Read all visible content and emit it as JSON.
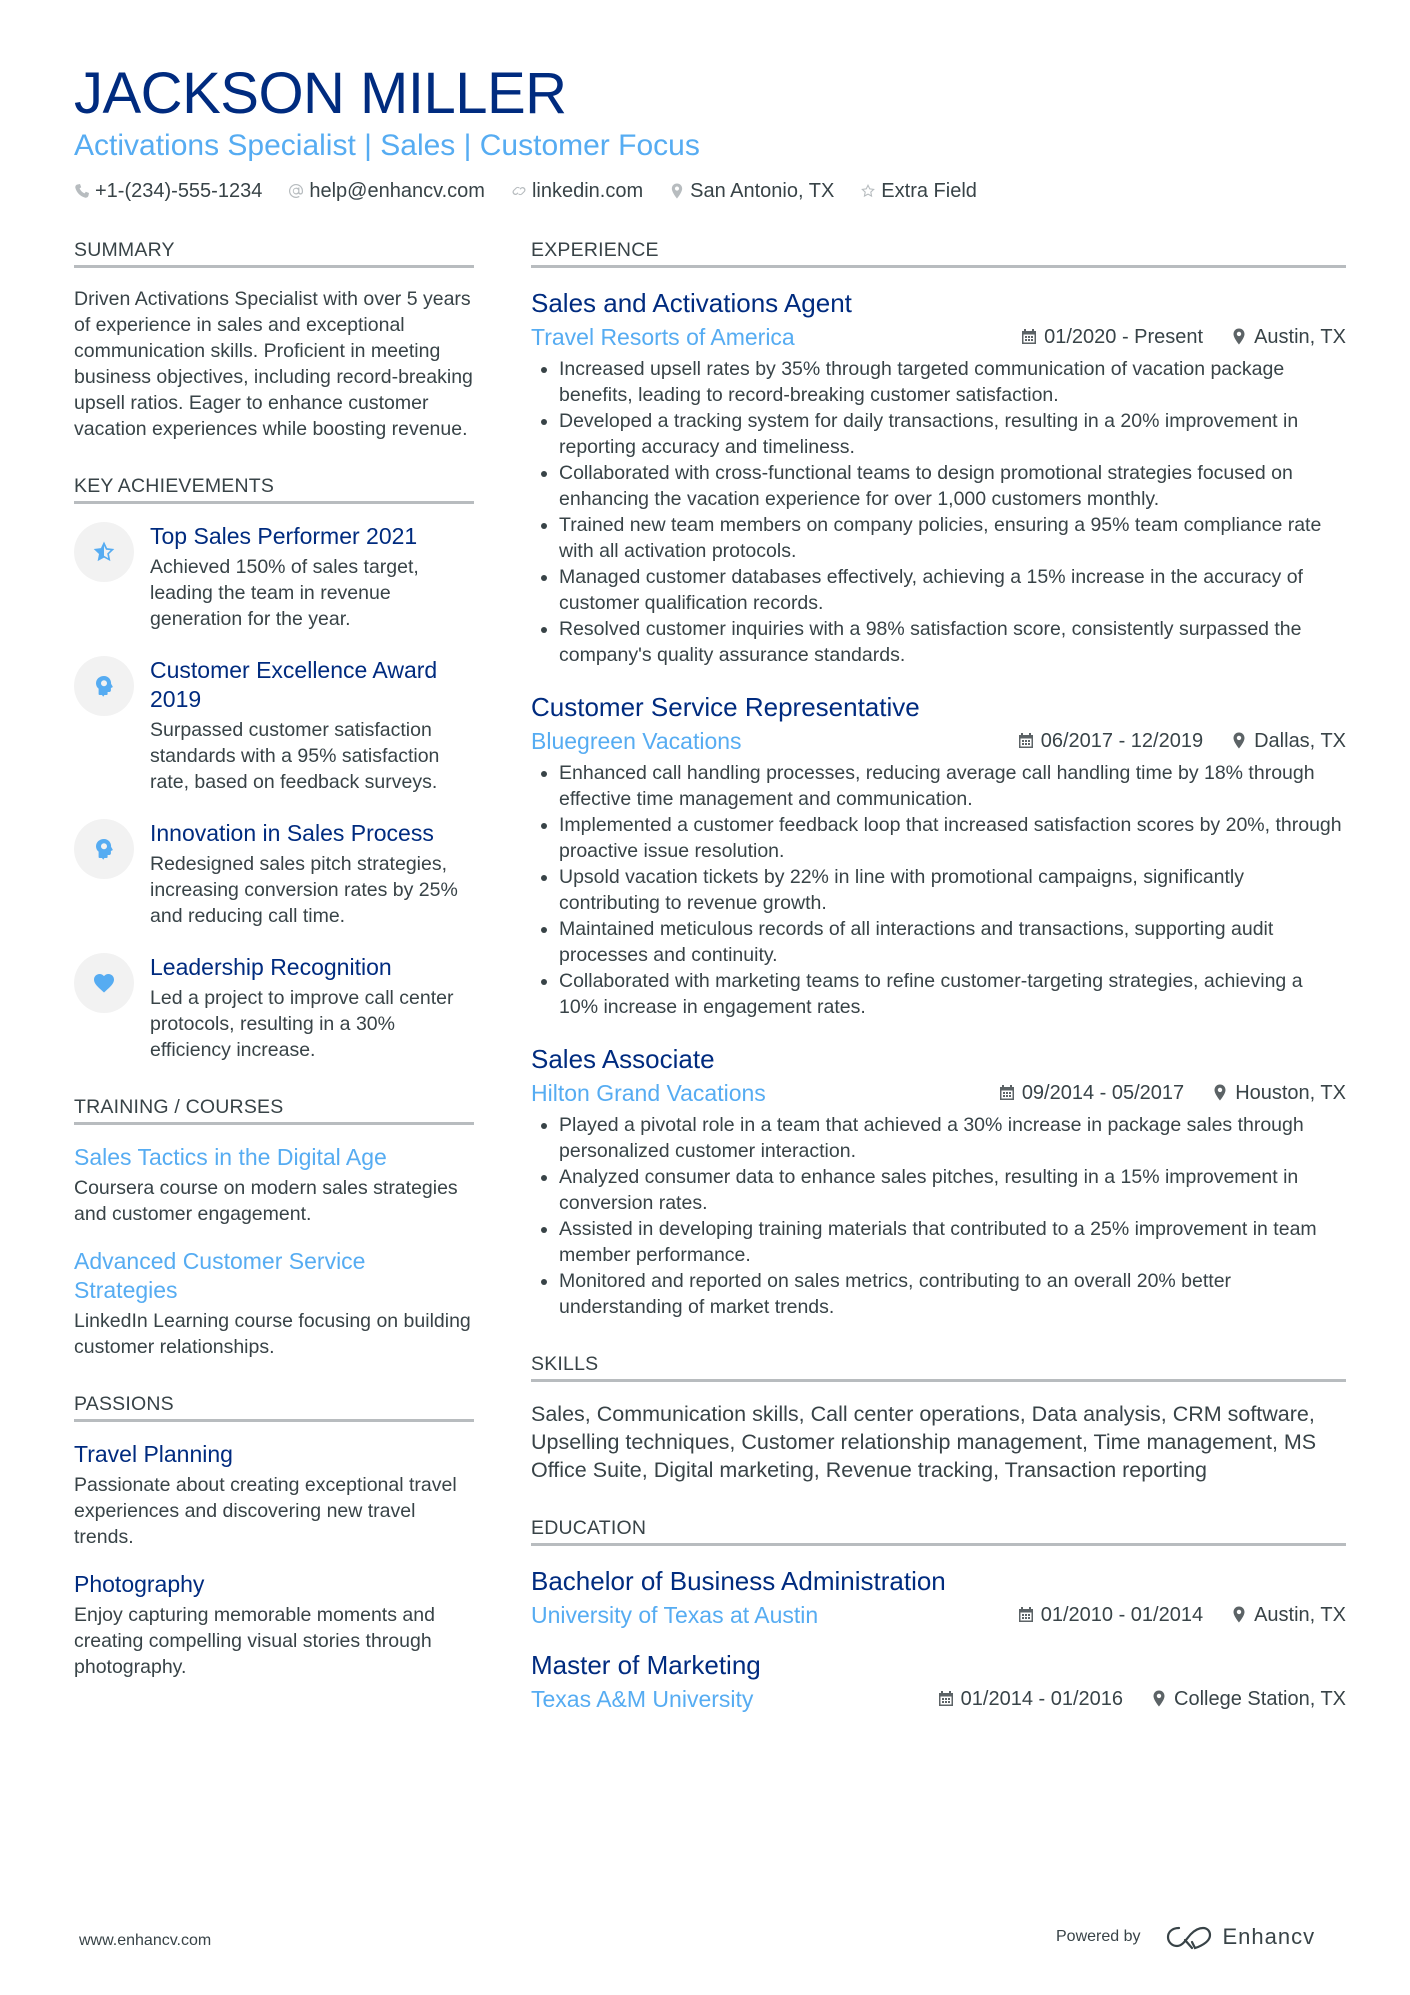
{
  "header": {
    "name": "JACKSON MILLER",
    "subtitle": "Activations Specialist | Sales | Customer Focus",
    "contacts": [
      {
        "icon": "phone-icon",
        "text": "+1-(234)-555-1234"
      },
      {
        "icon": "at-icon",
        "text": "help@enhancv.com"
      },
      {
        "icon": "link-icon",
        "text": "linkedin.com"
      },
      {
        "icon": "location-icon",
        "text": "San Antonio, TX"
      },
      {
        "icon": "star-icon",
        "text": "Extra Field"
      }
    ]
  },
  "summary": {
    "title": "SUMMARY",
    "text": "Driven Activations Specialist with over 5 years of experience in sales and exceptional communication skills. Proficient in meeting business objectives, including record-breaking upsell ratios. Eager to enhance customer vacation experiences while boosting revenue."
  },
  "achievements": {
    "title": "KEY ACHIEVEMENTS",
    "items": [
      {
        "icon": "star-icon",
        "title": "Top Sales Performer 2021",
        "text": "Achieved 150% of sales target, leading the team in revenue generation for the year."
      },
      {
        "icon": "head-icon",
        "title": "Customer Excellence Award 2019",
        "text": "Surpassed customer satisfaction standards with a 95% satisfaction rate, based on feedback surveys."
      },
      {
        "icon": "head-icon",
        "title": "Innovation in Sales Process",
        "text": "Redesigned sales pitch strategies, increasing conversion rates by 25% and reducing call time."
      },
      {
        "icon": "heart-icon",
        "title": "Leadership Recognition",
        "text": "Led a project to improve call center protocols, resulting in a 30% efficiency increase."
      }
    ]
  },
  "training": {
    "title": "TRAINING / COURSES",
    "items": [
      {
        "title": "Sales Tactics in the Digital Age",
        "text": "Coursera course on modern sales strategies and customer engagement."
      },
      {
        "title": "Advanced Customer Service Strategies",
        "text": "LinkedIn Learning course focusing on building customer relationships."
      }
    ]
  },
  "passions": {
    "title": "PASSIONS",
    "items": [
      {
        "title": "Travel Planning",
        "text": "Passionate about creating exceptional travel experiences and discovering new travel trends."
      },
      {
        "title": "Photography",
        "text": "Enjoy capturing memorable moments and creating compelling visual stories through photography."
      }
    ]
  },
  "experience": {
    "title": "EXPERIENCE",
    "jobs": [
      {
        "title": "Sales and Activations Agent",
        "company": "Travel Resorts of America",
        "dates": "01/2020 - Present",
        "location": "Austin, TX",
        "bullets": [
          "Increased upsell rates by 35% through targeted communication of vacation package benefits, leading to record-breaking customer satisfaction.",
          "Developed a tracking system for daily transactions, resulting in a 20% improvement in reporting accuracy and timeliness.",
          "Collaborated with cross-functional teams to design promotional strategies focused on enhancing the vacation experience for over 1,000 customers monthly.",
          "Trained new team members on company policies, ensuring a 95% team compliance rate with all activation protocols.",
          "Managed customer databases effectively, achieving a 15% increase in the accuracy of customer qualification records.",
          "Resolved customer inquiries with a 98% satisfaction score, consistently surpassed the company's quality assurance standards."
        ]
      },
      {
        "title": "Customer Service Representative",
        "company": "Bluegreen Vacations",
        "dates": "06/2017 - 12/2019",
        "location": "Dallas, TX",
        "bullets": [
          "Enhanced call handling processes, reducing average call handling time by 18% through effective time management and communication.",
          "Implemented a customer feedback loop that increased satisfaction scores by 20%, through proactive issue resolution.",
          "Upsold vacation tickets by 22% in line with promotional campaigns, significantly contributing to revenue growth.",
          "Maintained meticulous records of all interactions and transactions, supporting audit processes and continuity.",
          "Collaborated with marketing teams to refine customer-targeting strategies, achieving a 10% increase in engagement rates."
        ]
      },
      {
        "title": "Sales Associate",
        "company": "Hilton Grand Vacations",
        "dates": "09/2014 - 05/2017",
        "location": "Houston, TX",
        "bullets": [
          "Played a pivotal role in a team that achieved a 30% increase in package sales through personalized customer interaction.",
          "Analyzed consumer data to enhance sales pitches, resulting in a 15% improvement in conversion rates.",
          "Assisted in developing training materials that contributed to a 25% improvement in team member performance.",
          "Monitored and reported on sales metrics, contributing to an overall 20% better understanding of market trends."
        ]
      }
    ]
  },
  "skills": {
    "title": "SKILLS",
    "text": "Sales, Communication skills, Call center operations, Data analysis, CRM software, Upselling techniques, Customer relationship management, Time management, MS Office Suite, Digital marketing, Revenue tracking, Transaction reporting"
  },
  "education": {
    "title": "EDUCATION",
    "items": [
      {
        "degree": "Bachelor of Business Administration",
        "school": "University of Texas at Austin",
        "dates": "01/2010 - 01/2014",
        "location": "Austin, TX"
      },
      {
        "degree": "Master of Marketing",
        "school": "Texas A&M University",
        "dates": "01/2014 - 01/2016",
        "location": "College Station, TX"
      }
    ]
  },
  "footer": {
    "website": "www.enhancv.com",
    "powered_by": "Powered by",
    "brand": "Enhancv"
  },
  "colors": {
    "name": "#002b7f",
    "accent": "#56acf2",
    "text": "#384347",
    "divider": "#b8bcbf"
  }
}
